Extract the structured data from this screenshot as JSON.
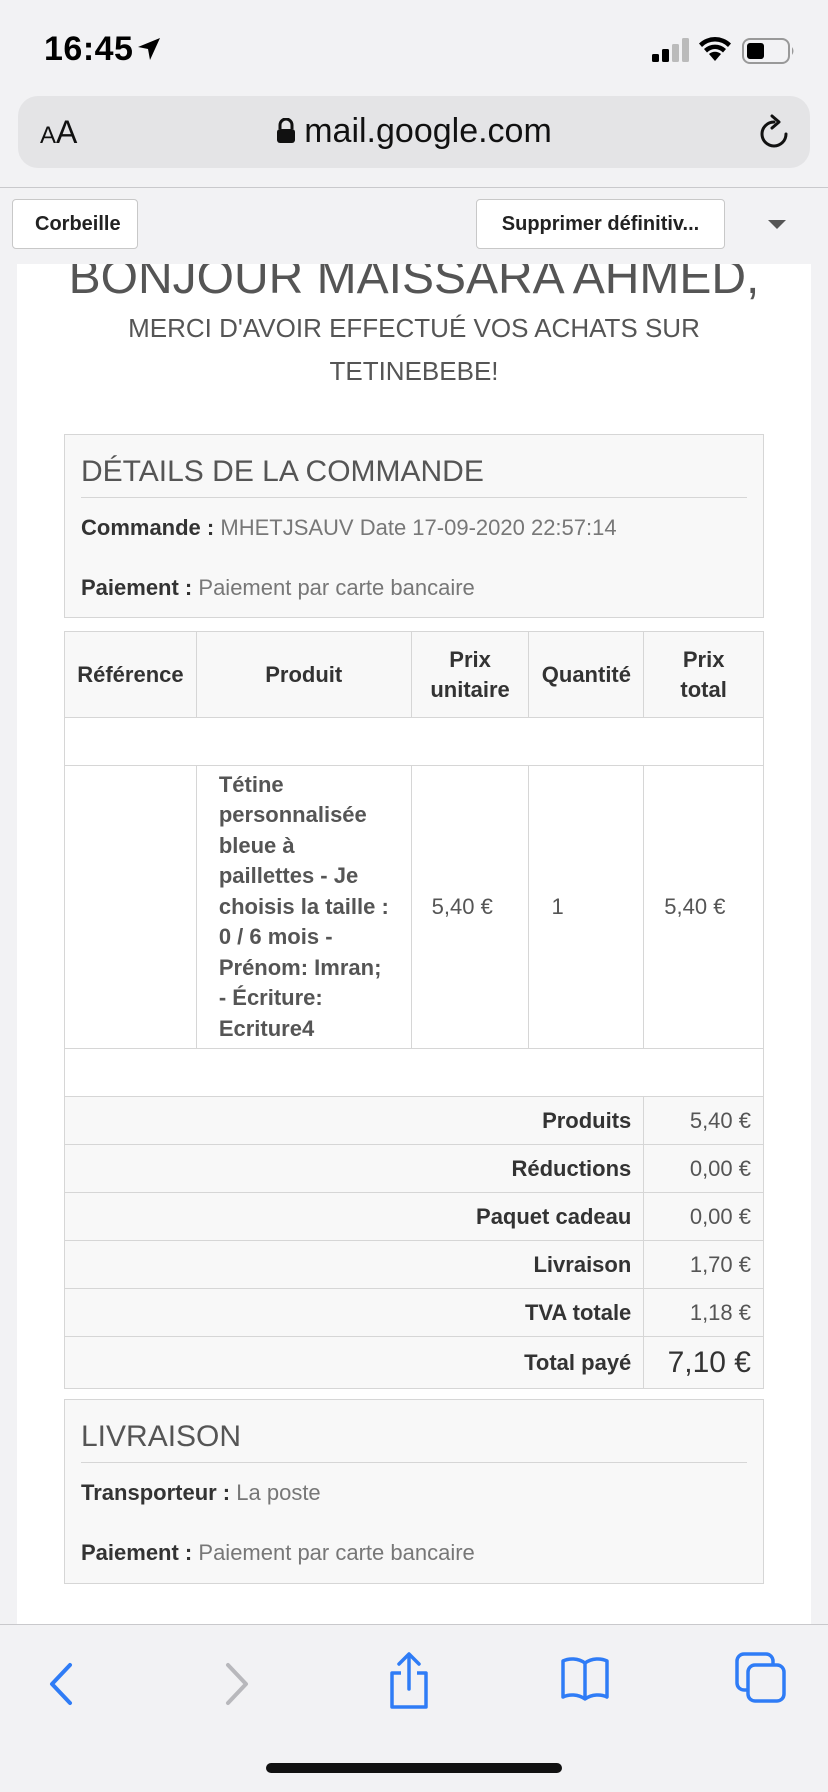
{
  "status_bar": {
    "time": "16:45"
  },
  "url_bar": {
    "aa_small": "A",
    "aa_large": "A",
    "url": "mail.google.com"
  },
  "toolbar": {
    "back_label": "Corbeille",
    "delete_label": "Supprimer définitiv..."
  },
  "email": {
    "greeting": "BONJOUR MAISSARA AHMED,",
    "thanks": "MERCI D'AVOIR EFFECTUÉ VOS ACHATS SUR TETINEBEBE!",
    "order_details": {
      "title": "DÉTAILS DE LA COMMANDE",
      "order_label": "Commande :",
      "order_value": "MHETJSAUV Date 17-09-2020 22:57:14",
      "payment_label": "Paiement :",
      "payment_value": "Paiement par carte bancaire"
    },
    "table": {
      "headers": [
        "Référence",
        "Produit",
        "Prix unitaire",
        "Quantité",
        "Prix total"
      ],
      "item": {
        "reference": "",
        "product": "Tétine personnalisée bleue à paillettes - Je choisis la taille : 0 / 6 mois - Prénom: Imran; - Écriture: Ecriture4",
        "unit_price": "5,40 €",
        "quantity": "1",
        "total_price": "5,40 €"
      },
      "totals": [
        {
          "label": "Produits",
          "value": "5,40 €"
        },
        {
          "label": "Réductions",
          "value": "0,00 €"
        },
        {
          "label": "Paquet cadeau",
          "value": "0,00 €"
        },
        {
          "label": "Livraison",
          "value": "1,70 €"
        },
        {
          "label": "TVA totale",
          "value": "1,18 €"
        },
        {
          "label": "Total payé",
          "value": "7,10 €"
        }
      ]
    },
    "delivery": {
      "title": "LIVRAISON",
      "carrier_label": "Transporteur :",
      "carrier_value": "La poste",
      "payment_label": "Paiement :",
      "payment_value": "Paiement par carte bancaire"
    }
  },
  "bottom_bar": {
    "icons": [
      "back-icon",
      "forward-icon",
      "share-icon",
      "bookmarks-icon",
      "tabs-icon"
    ],
    "accent": "#2f7cf6",
    "disabled": "#b8b8bc"
  }
}
